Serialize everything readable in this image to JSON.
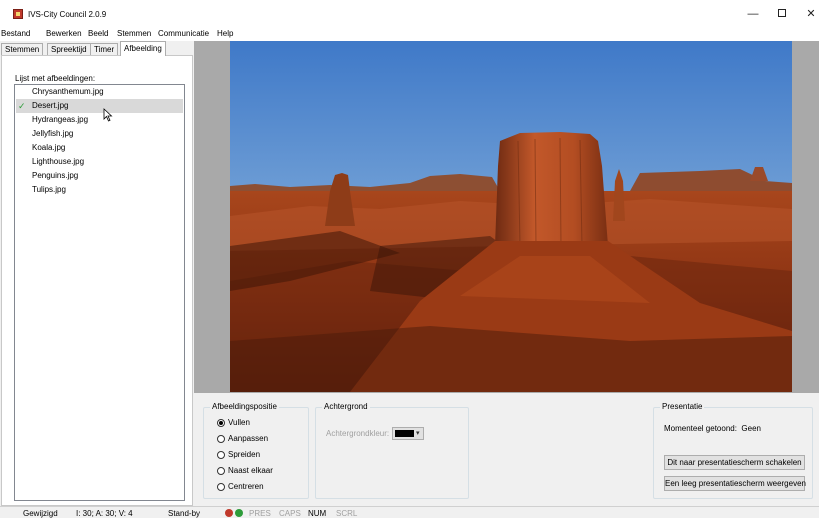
{
  "window": {
    "title": "IVS-City Council 2.0.9",
    "minimize": "—",
    "close": "✕"
  },
  "menu": [
    "Bestand",
    "Bewerken",
    "Beeld",
    "Stemmen",
    "Communicatie",
    "Help"
  ],
  "tabs": [
    "Stemmen",
    "Spreektijd",
    "Timer",
    "Afbeelding"
  ],
  "active_tab": "Afbeelding",
  "image_list": {
    "label": "Lijst met afbeeldingen:",
    "items": [
      "Chrysanthemum.jpg",
      "Desert.jpg",
      "Hydrangeas.jpg",
      "Jellyfish.jpg",
      "Koala.jpg",
      "Lighthouse.jpg",
      "Penguins.jpg",
      "Tulips.jpg"
    ],
    "selected": "Desert.jpg",
    "check": "✓"
  },
  "position_group": {
    "title": "Afbeeldingspositie",
    "options": [
      "Vullen",
      "Aanpassen",
      "Spreiden",
      "Naast elkaar",
      "Centreren"
    ],
    "selected": "Vullen"
  },
  "background_group": {
    "title": "Achtergrond",
    "color_label": "Achtergrondkleur:",
    "color_value": "#000000",
    "dropdown_arrow": "▾"
  },
  "presentation_group": {
    "title": "Presentatie",
    "now_shown_label": "Momenteel getoond:",
    "now_shown_value": "Geen",
    "switch_button": "Dit naar presentatiescherm schakelen",
    "empty_button": "Een leeg presentatiescherm weergeven"
  },
  "status": {
    "state": "Gewijzigd",
    "counts": "I: 30;  A: 30;  V: 4",
    "mode": "Stand-by",
    "pres": "PRES",
    "caps": "CAPS",
    "num": "NUM",
    "scrl": "SCRL"
  },
  "colors": {
    "check": "#2e9c3a",
    "status_red": "#c0392b",
    "status_green": "#2e9c3a",
    "preview_bg": "#a9a9a9"
  }
}
